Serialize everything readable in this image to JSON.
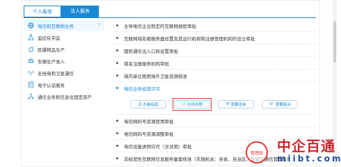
{
  "tabs": [
    {
      "label": "个人服务"
    },
    {
      "label": "法人服务"
    }
  ],
  "sidebar": {
    "items": [
      {
        "label": "电信和互联网业务",
        "icon": "globe-icon",
        "active": true
      },
      {
        "label": "监控化学品",
        "icon": "flask-icon"
      },
      {
        "label": "民爆物品生产",
        "icon": "explosive-icon"
      },
      {
        "label": "车辆生产准入",
        "icon": "car-icon"
      },
      {
        "label": "无线电和卫星通信",
        "icon": "antenna-icon"
      },
      {
        "label": "电子认证服务",
        "icon": "certificate-icon"
      },
      {
        "label": "通信业务和信息化固定资产",
        "icon": "network-icon"
      }
    ],
    "arrow": "›"
  },
  "services_top": [
    "主导电信企业制定的互联网规程审批",
    "互联网域名根服务器设置及其运行机构和注册管理机构的设立审批",
    "国际通信出入口局设置审批",
    "域名注册服务机构审批",
    "境内单位租用境外卫星资源核准",
    "电信业务经营许可"
  ],
  "panel": {
    "buttons": [
      {
        "label": "办事指南",
        "icon": "guide-icon"
      },
      {
        "label": "在线办理",
        "icon": "monitor-icon"
      },
      {
        "label": "我要咨询",
        "icon": "chat-icon"
      },
      {
        "label": "我要投诉",
        "icon": "complaint-icon"
      }
    ]
  },
  "services_bottom": [
    "电信网码号资源使用审批",
    "电信网码号资源调整审批",
    "电信设备进网许可（含试用）审批",
    "非经营性互联网信息服务备案核准（实施机关：各省、自治区、直辖市通信管理局）"
  ],
  "watermark": {
    "main": "中企百通",
    "sub": "miibt.com",
    "stamp": "管理局"
  },
  "colors": {
    "accent": "#1a88d4",
    "highlight": "#e23b2e"
  }
}
